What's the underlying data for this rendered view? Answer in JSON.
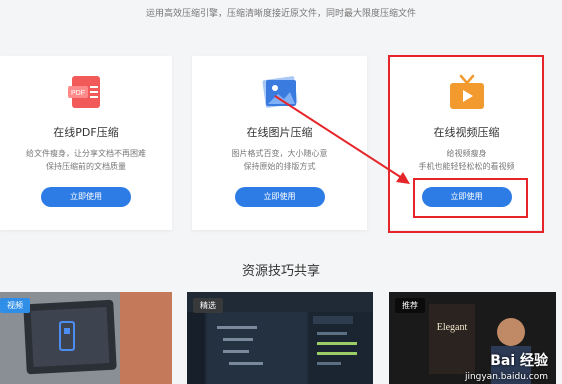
{
  "header": {
    "subtitle": "运用高效压缩引擎，压缩清晰度接近原文件，同时最大限度压缩文件"
  },
  "cards": [
    {
      "title": "在线PDF压缩",
      "desc_line1": "给文件瘦身，让分享文档不再困难",
      "desc_line2": "保持压缩前的文档质量",
      "button": "立即使用",
      "icon": "pdf-icon",
      "icon_text": "PDF"
    },
    {
      "title": "在线图片压缩",
      "desc_line1": "图片格式百变，大小随心意",
      "desc_line2": "保持原始的排版方式",
      "button": "立即使用",
      "icon": "image-icon"
    },
    {
      "title": "在线视频压缩",
      "desc_line1": "给视频瘦身",
      "desc_line2": "手机也能轻轻松松的看视频",
      "button": "立即使用",
      "icon": "tv-play-icon"
    }
  ],
  "resources": {
    "title": "资源技巧共享",
    "thumbnails": [
      {
        "tag": "视频",
        "subject": "laptop-icon"
      },
      {
        "tag": "精选",
        "subject": "code-editor"
      },
      {
        "tag": "推荐",
        "subject": "person-book",
        "book_title": "Elegant"
      }
    ],
    "watermark": "Bai 经验",
    "watermark_url": "jingyan.baidu.com"
  },
  "colors": {
    "accent": "#2d7ce6",
    "highlight": "#e5252a",
    "pdf": "#f25a5a",
    "image": "#3a7be0",
    "video": "#f29a2e"
  }
}
